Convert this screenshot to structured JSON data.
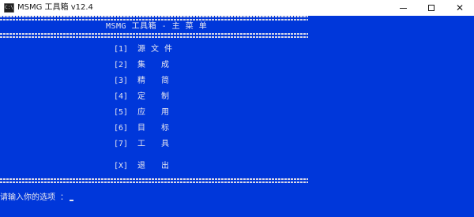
{
  "window": {
    "title": "MSMG 工具箱 v12.4",
    "icon_name": "console-app-icon",
    "icon_text": "C:\\",
    "controls": {
      "minimize": "minimize-icon",
      "maximize": "maximize-icon",
      "close": "close-icon"
    }
  },
  "console": {
    "background": "#0037da",
    "header": "MSMG 工具箱 - 主 菜 单",
    "menu": [
      {
        "key": "[1]",
        "label": "源文件"
      },
      {
        "key": "[2]",
        "label": "集 成"
      },
      {
        "key": "[3]",
        "label": "精 简"
      },
      {
        "key": "[4]",
        "label": "定 制"
      },
      {
        "key": "[5]",
        "label": "应 用"
      },
      {
        "key": "[6]",
        "label": "目 标"
      },
      {
        "key": "[7]",
        "label": "工 具"
      },
      {
        "key": "[X]",
        "label": "退 出"
      }
    ],
    "prompt": "请输入你的选项 ："
  }
}
